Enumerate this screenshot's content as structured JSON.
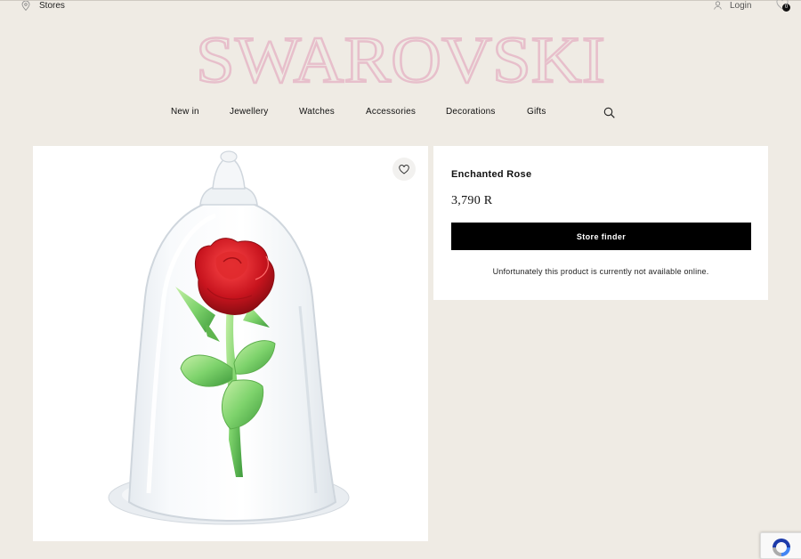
{
  "header": {
    "stores_label": "Stores",
    "login_label": "Login",
    "cart_count": "0",
    "brand": "SWAROVSKI",
    "brand_color": "#e7bfcb"
  },
  "nav": {
    "items": [
      {
        "label": "New in"
      },
      {
        "label": "Jewellery"
      },
      {
        "label": "Watches"
      },
      {
        "label": "Accessories"
      },
      {
        "label": "Decorations"
      },
      {
        "label": "Gifts"
      }
    ]
  },
  "product": {
    "name": "Enchanted Rose",
    "price": "3,790 R",
    "store_finder_label": "Store finder",
    "availability": "Unfortunately this product is currently not available online."
  },
  "icons": [
    "map-pin-icon",
    "user-icon",
    "heart-icon",
    "search-icon",
    "recaptcha-icon"
  ],
  "colors": {
    "background": "#efebe4",
    "panel": "#ffffff",
    "button": "#000000",
    "rose": "#c8141e",
    "leaf": "#7ed36c"
  }
}
